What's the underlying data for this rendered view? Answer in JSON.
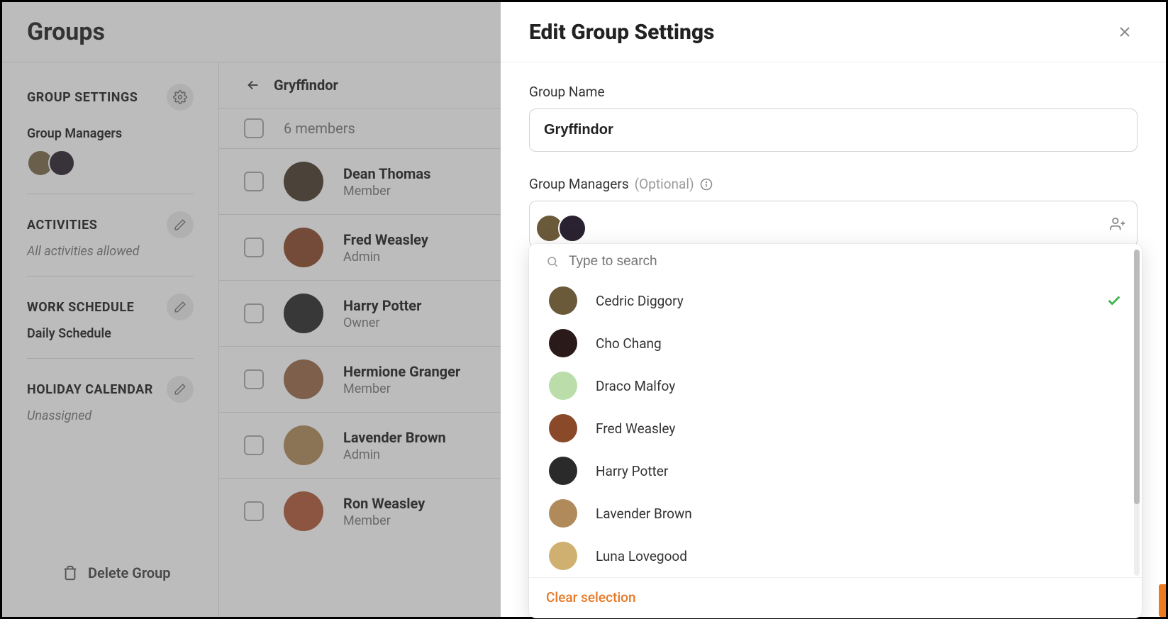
{
  "page": {
    "title": "Groups"
  },
  "sidebar": {
    "settings_label": "GROUP SETTINGS",
    "managers_label": "Group Managers",
    "activities_label": "ACTIVITIES",
    "activities_value": "All activities allowed",
    "schedule_label": "WORK SCHEDULE",
    "schedule_value": "Daily Schedule",
    "holiday_label": "HOLIDAY CALENDAR",
    "holiday_value": "Unassigned",
    "delete_label": "Delete Group",
    "manager_avatars": [
      "#7b6a4a",
      "#2a2230"
    ]
  },
  "content": {
    "group_name": "Gryffindor",
    "count_label": "6 members",
    "members": [
      {
        "name": "Dean Thomas",
        "role": "Member",
        "color": "#4a3b2e"
      },
      {
        "name": "Fred Weasley",
        "role": "Admin",
        "color": "#8a4a2a"
      },
      {
        "name": "Harry Potter",
        "role": "Owner",
        "color": "#2a2a2a"
      },
      {
        "name": "Hermione Granger",
        "role": "Member",
        "color": "#9a6a4a"
      },
      {
        "name": "Lavender Brown",
        "role": "Admin",
        "color": "#b08a5a"
      },
      {
        "name": "Ron Weasley",
        "role": "Member",
        "color": "#b05a3a"
      }
    ]
  },
  "panel": {
    "title": "Edit Group Settings",
    "group_name_label": "Group Name",
    "group_name_value": "Gryffindor",
    "managers_label": "Group Managers",
    "managers_optional": "(Optional)",
    "search_placeholder": "Type to search",
    "clear_label": "Clear selection",
    "people": [
      {
        "name": "Cedric Diggory",
        "selected": true,
        "color": "#6a5a3a"
      },
      {
        "name": "Cho Chang",
        "selected": false,
        "color": "#2a1a1a"
      },
      {
        "name": "Draco Malfoy",
        "selected": false,
        "color": "#bda"
      },
      {
        "name": "Fred Weasley",
        "selected": false,
        "color": "#8a4a2a"
      },
      {
        "name": "Harry Potter",
        "selected": false,
        "color": "#2a2a2a"
      },
      {
        "name": "Lavender Brown",
        "selected": false,
        "color": "#b08a5a"
      },
      {
        "name": "Luna Lovegood",
        "selected": false,
        "color": "#d0b070"
      }
    ],
    "selected_avatars": [
      "#6a5a3a",
      "#2a2230"
    ]
  },
  "colors": {
    "accent": "#e57928"
  }
}
